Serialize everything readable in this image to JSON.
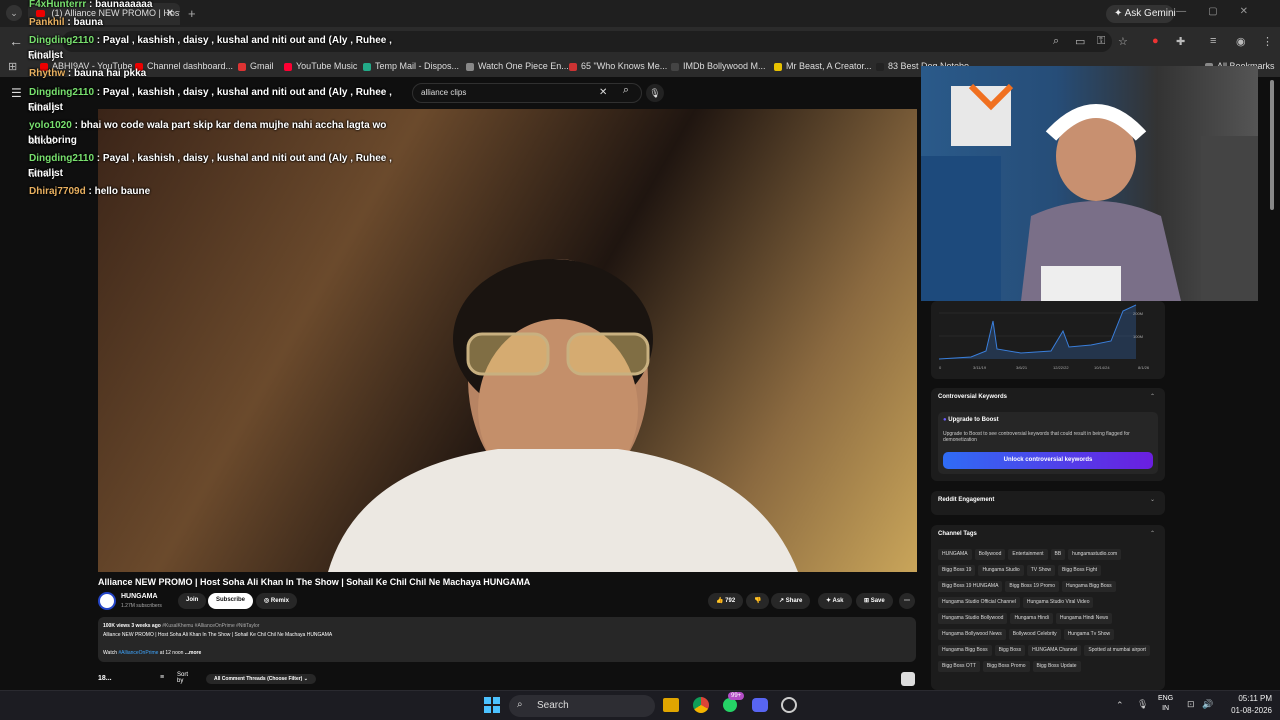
{
  "browser": {
    "tab_title": "(1) Alliance NEW PROMO | Host",
    "new_tab_symbol": "+",
    "ask_gemini": "Ask Gemini",
    "bookmarks": [
      {
        "label": "ABHI9AV - YouTube",
        "color": "#e00"
      },
      {
        "label": "Channel dashboard...",
        "color": "#e00"
      },
      {
        "label": "Gmail",
        "color": "#d33"
      },
      {
        "label": "YouTube Music",
        "color": "#f03"
      },
      {
        "label": "Temp Mail - Dispos...",
        "color": "#2a8"
      },
      {
        "label": "Watch One Piece En...",
        "color": "#888"
      },
      {
        "label": "65 \"Who Knows Me...",
        "color": "#c33"
      },
      {
        "label": "IMDb Bollywood M...",
        "color": "#444"
      },
      {
        "label": "Mr Beast, A Creator...",
        "color": "#e8c200"
      },
      {
        "label": "83 Best Dog Notebo...",
        "color": "#222"
      },
      {
        "label": "All Bookmarks",
        "color": "#888"
      }
    ]
  },
  "youtube": {
    "search_value": "alliance clips",
    "video_title": "Alliance NEW PROMO | Host Soha Ali Khan In The Show | Sohail Ke Chil Chil Ne Machaya HUNGAMA",
    "channel_name": "HUNGAMA",
    "channel_subs": "1.27M subscribers",
    "join_label": "Join",
    "subscribe_label": "Subscribe",
    "remix_label": "Remix",
    "likes": "792",
    "share_label": "Share",
    "ask_label": "Ask",
    "save_label": "Save",
    "desc_stats": "100K views  3 weeks ago",
    "desc_tags": "#KusalKhemu #AllianceOnPrime #NitiTaylor",
    "desc_line": "Alliance NEW PROMO | Host Soha Ali Khan In The Show | Sohail Ke Chil Chil Ne Machaya HUNGAMA",
    "desc_watch_prefix": "Watch",
    "desc_watch_link": "#AllianceOnPrime",
    "desc_watch_suffix": "at 12 noon",
    "desc_more": "...more",
    "comments_count": "18...",
    "sort_label": "Sort by",
    "filter_label": "All Comment Threads (Choose Filter)"
  },
  "chat": [
    {
      "user": "F4xHunterrr",
      "text": "baunaaaaaa"
    },
    {
      "user": "Pankhil",
      "text": "bauna"
    },
    {
      "user": "Dingding2110",
      "text": "Payal , kashish , daisy , kushal and niti out and (Aly , Ruhee , Mini )"
    },
    {
      "plain": "Finalist"
    },
    {
      "user": "Rhythw",
      "text": "bauna hai pkka"
    },
    {
      "user": "Dingding2110",
      "text": "Payal , kashish , daisy , kushal and niti out and (Aly , Ruhee , Mini )"
    },
    {
      "plain": "Finalist"
    },
    {
      "user": "yolo1020",
      "text": "bhai wo code wala part skip kar dena mujhe nahi accha lagta wo bilkul"
    },
    {
      "plain": "bhi boring"
    },
    {
      "user": "Dingding2110",
      "text": "Payal , kashish , daisy , kushal and niti out and (Aly , Ruhee , Mini )"
    },
    {
      "plain": "Finalist"
    },
    {
      "user": "Dhiraj7709d",
      "text": "hello baune"
    }
  ],
  "sidebar": {
    "chart": {
      "y_ticks": [
        "200M",
        "100M"
      ],
      "x_ticks": [
        "0",
        "3/11/19",
        "3/6/21",
        "12/22/22",
        "10/14/24",
        "8/1/26"
      ]
    },
    "controversial_title": "Controversial Keywords",
    "upgrade_title": "Upgrade to Boost",
    "upgrade_text": "Upgrade to Boost to see controversial keywords that could result in being flagged for demonetization",
    "unlock_label": "Unlock controversial keywords",
    "reddit_title": "Reddit Engagement",
    "tags_title": "Channel Tags",
    "tags": [
      "HUNGAMA",
      "Bollywood",
      "Entertainment",
      "BB",
      "hungamastudio.com",
      "Bigg Boss 19",
      "Hungama Studio",
      "TV Show",
      "Bigg Boss Fight",
      "Bigg Boss 19 HUNGAMA",
      "Bigg Boss 19 Promo",
      "Hungama Bigg Boss",
      "Hungama Studio Official Channel",
      "Hungama Studio Viral Video",
      "Hungama Studio Bollywood",
      "Hungama Hindi",
      "Hungama Hindi News",
      "Hungama Bollywood News",
      "Bollywood Celebrity",
      "Hungama Tv Show",
      "Hungama Bigg Boss",
      "Bigg Boss",
      "HUNGAMA Channel",
      "Spotted at mumbai airport",
      "Bigg Boss OTT",
      "Bigg Boss Promo",
      "Bigg Boss Update"
    ]
  },
  "taskbar": {
    "search_label": "Search",
    "badge": "99+",
    "lang_top": "ENG",
    "lang_bottom": "IN",
    "time": "05:11 PM",
    "date": "01-08-2026"
  }
}
